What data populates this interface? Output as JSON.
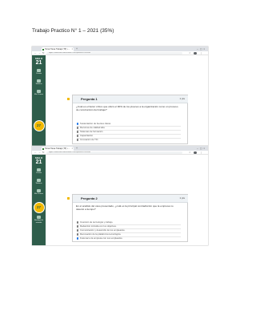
{
  "document": {
    "title": "Trabajo Practico N° 1 – 2021 (35%)"
  },
  "screenshots": [
    {
      "browser": {
        "tab_title": "Tomar Tarea Trabajo (TP) • ...",
        "url": "siglo21.instructure.com/courses/17853/quizzes/97645/take"
      },
      "sidebar": {
        "logo_small": "SIGLO",
        "logo_big": "21",
        "items": [
          "Cuenta",
          "Tableros",
          "Mis Cursos"
        ],
        "badge": "27"
      },
      "question": {
        "title": "Pregunta 1",
        "points": "1 pts",
        "text": "¿Cuál es el factor crítico que ubicó el 90% de los jóvenes a la organización como un proceso de construcción del trabajo?",
        "options": [
          {
            "label": "Sustentación de fuentes claras",
            "selected": true
          },
          {
            "label": "Recursos de calidad alta",
            "selected": false
          },
          {
            "label": "Sistemas de formación",
            "selected": false
          },
          {
            "label": "Capacitación",
            "selected": false
          },
          {
            "label": "Innovación de TIC",
            "selected": false
          }
        ]
      }
    },
    {
      "browser": {
        "tab_title": "Tomar Tarea Trabajo (TP) • ...",
        "url": "siglo21.instructure.com/courses/17853/quizzes/97645/take"
      },
      "sidebar": {
        "logo_small": "SIGLO",
        "logo_big": "21",
        "items": [
          "Cuenta",
          "Tableros",
          "Mis Cursos",
          "Bandeja de entrada"
        ],
        "badge": "27"
      },
      "question": {
        "title": "Pregunta 2",
        "points": "1 pts",
        "text": "En el análisis del caso presentado, ¿cuál es la principal contradicción que la empresa no detectó a tiempo?",
        "options": [
          {
            "label": "Inversión de tecnología y trabajo.",
            "selected": false
          },
          {
            "label": "Redacción incluida con los objetivos.",
            "selected": false
          },
          {
            "label": "Comunicación y desarrollo de los empleados.",
            "selected": false
          },
          {
            "label": "Renovación de la plataforma tecnológica.",
            "selected": false
          },
          {
            "label": "Fusionar a la empresa con sus empleados.",
            "selected": true
          }
        ]
      }
    }
  ]
}
